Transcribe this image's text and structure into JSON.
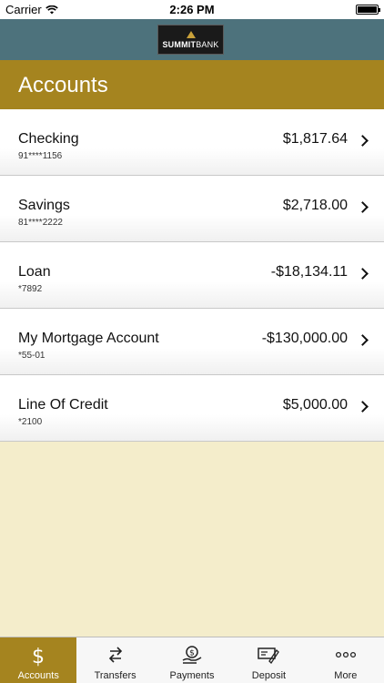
{
  "status_bar": {
    "carrier": "Carrier",
    "time": "2:26 PM"
  },
  "brand": {
    "logo_strong": "SUMMIT",
    "logo_light": "BANK"
  },
  "header": {
    "title": "Accounts"
  },
  "accounts": [
    {
      "name": "Checking",
      "number": "91****1156",
      "balance": "$1,817.64"
    },
    {
      "name": "Savings",
      "number": "81****2222",
      "balance": "$2,718.00"
    },
    {
      "name": "Loan",
      "number": "*7892",
      "balance": "-$18,134.11"
    },
    {
      "name": "My Mortgage Account",
      "number": "*55-01",
      "balance": "-$130,000.00"
    },
    {
      "name": "Line Of Credit",
      "number": "*2100",
      "balance": "$5,000.00"
    }
  ],
  "tabs": [
    {
      "label": "Accounts",
      "icon": "dollar-icon",
      "active": true
    },
    {
      "label": "Transfers",
      "icon": "transfer-arrows-icon",
      "active": false
    },
    {
      "label": "Payments",
      "icon": "hand-coin-icon",
      "active": false
    },
    {
      "label": "Deposit",
      "icon": "check-deposit-icon",
      "active": false
    },
    {
      "label": "More",
      "icon": "more-dots-icon",
      "active": false
    }
  ],
  "colors": {
    "brand_teal": "#4d727c",
    "gold": "#a5841f",
    "cream": "#f4edcb"
  }
}
